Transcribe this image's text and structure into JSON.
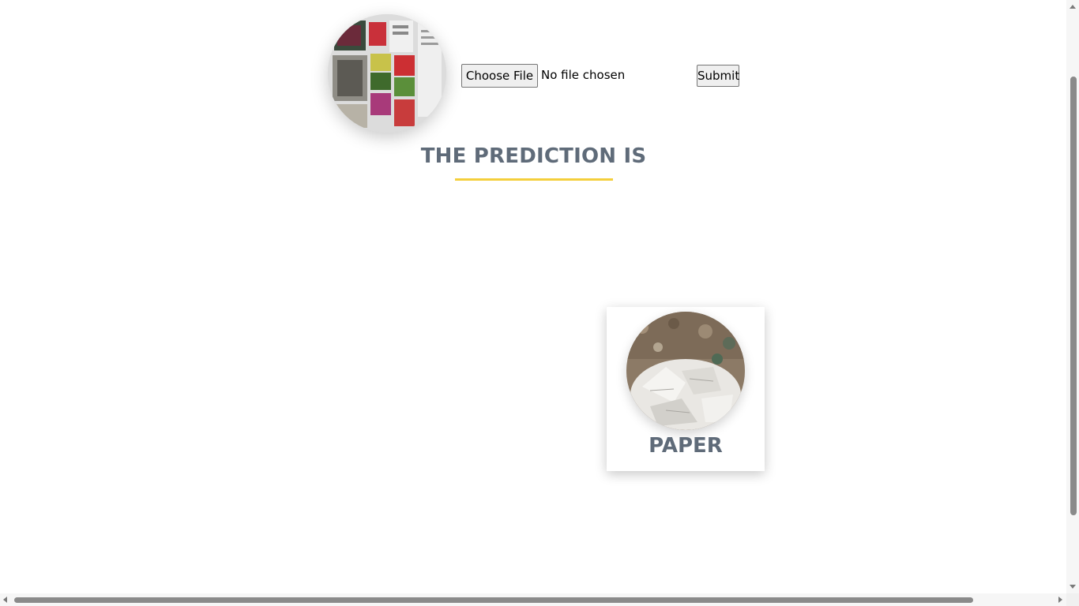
{
  "upload": {
    "preview_image": "newspaper-photo",
    "choose_file_label": "Choose File",
    "file_status": "No file chosen",
    "submit_label": "Submit"
  },
  "result": {
    "heading": "THE PREDICTION IS",
    "underline_color": "#f4cf3c",
    "card": {
      "image": "paper-waste-photo",
      "label": "PAPER"
    }
  },
  "colors": {
    "heading_text": "#5f6b79",
    "accent": "#f4cf3c",
    "background": "#ffffff"
  }
}
